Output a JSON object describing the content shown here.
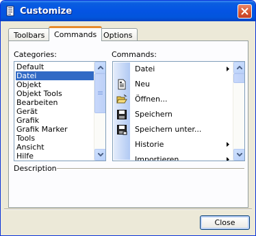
{
  "window": {
    "title": "Customize"
  },
  "tabs": [
    {
      "label": "Toolbars",
      "active": false
    },
    {
      "label": "Commands",
      "active": true
    },
    {
      "label": "Options",
      "active": false
    }
  ],
  "categories": {
    "label": "Categories:",
    "items": [
      "Default",
      "Datei",
      "Objekt",
      "Objekt Tools",
      "Bearbeiten",
      "Gerät",
      "Grafik",
      "Grafik Marker",
      "Tools",
      "Ansicht",
      "Hilfe"
    ],
    "selected": "Datei"
  },
  "commands": {
    "label": "Commands:",
    "items": [
      {
        "label": "Datei",
        "icon": "none",
        "submenu": true
      },
      {
        "label": "Neu",
        "icon": "new-document-icon",
        "submenu": false
      },
      {
        "label": "Öffnen...",
        "icon": "open-folder-icon",
        "submenu": false
      },
      {
        "label": "Speichern",
        "icon": "save-icon",
        "submenu": false
      },
      {
        "label": "Speichern unter...",
        "icon": "save-as-icon",
        "submenu": false
      },
      {
        "label": "Historie",
        "icon": "none",
        "submenu": true
      },
      {
        "label": "Importieren",
        "icon": "none",
        "submenu": true
      }
    ]
  },
  "description": {
    "label": "Description"
  },
  "buttons": {
    "close": "Close"
  },
  "colors": {
    "selection": "#316ac5",
    "titlebar": "#0454e3",
    "close_button": "#d5532c"
  }
}
